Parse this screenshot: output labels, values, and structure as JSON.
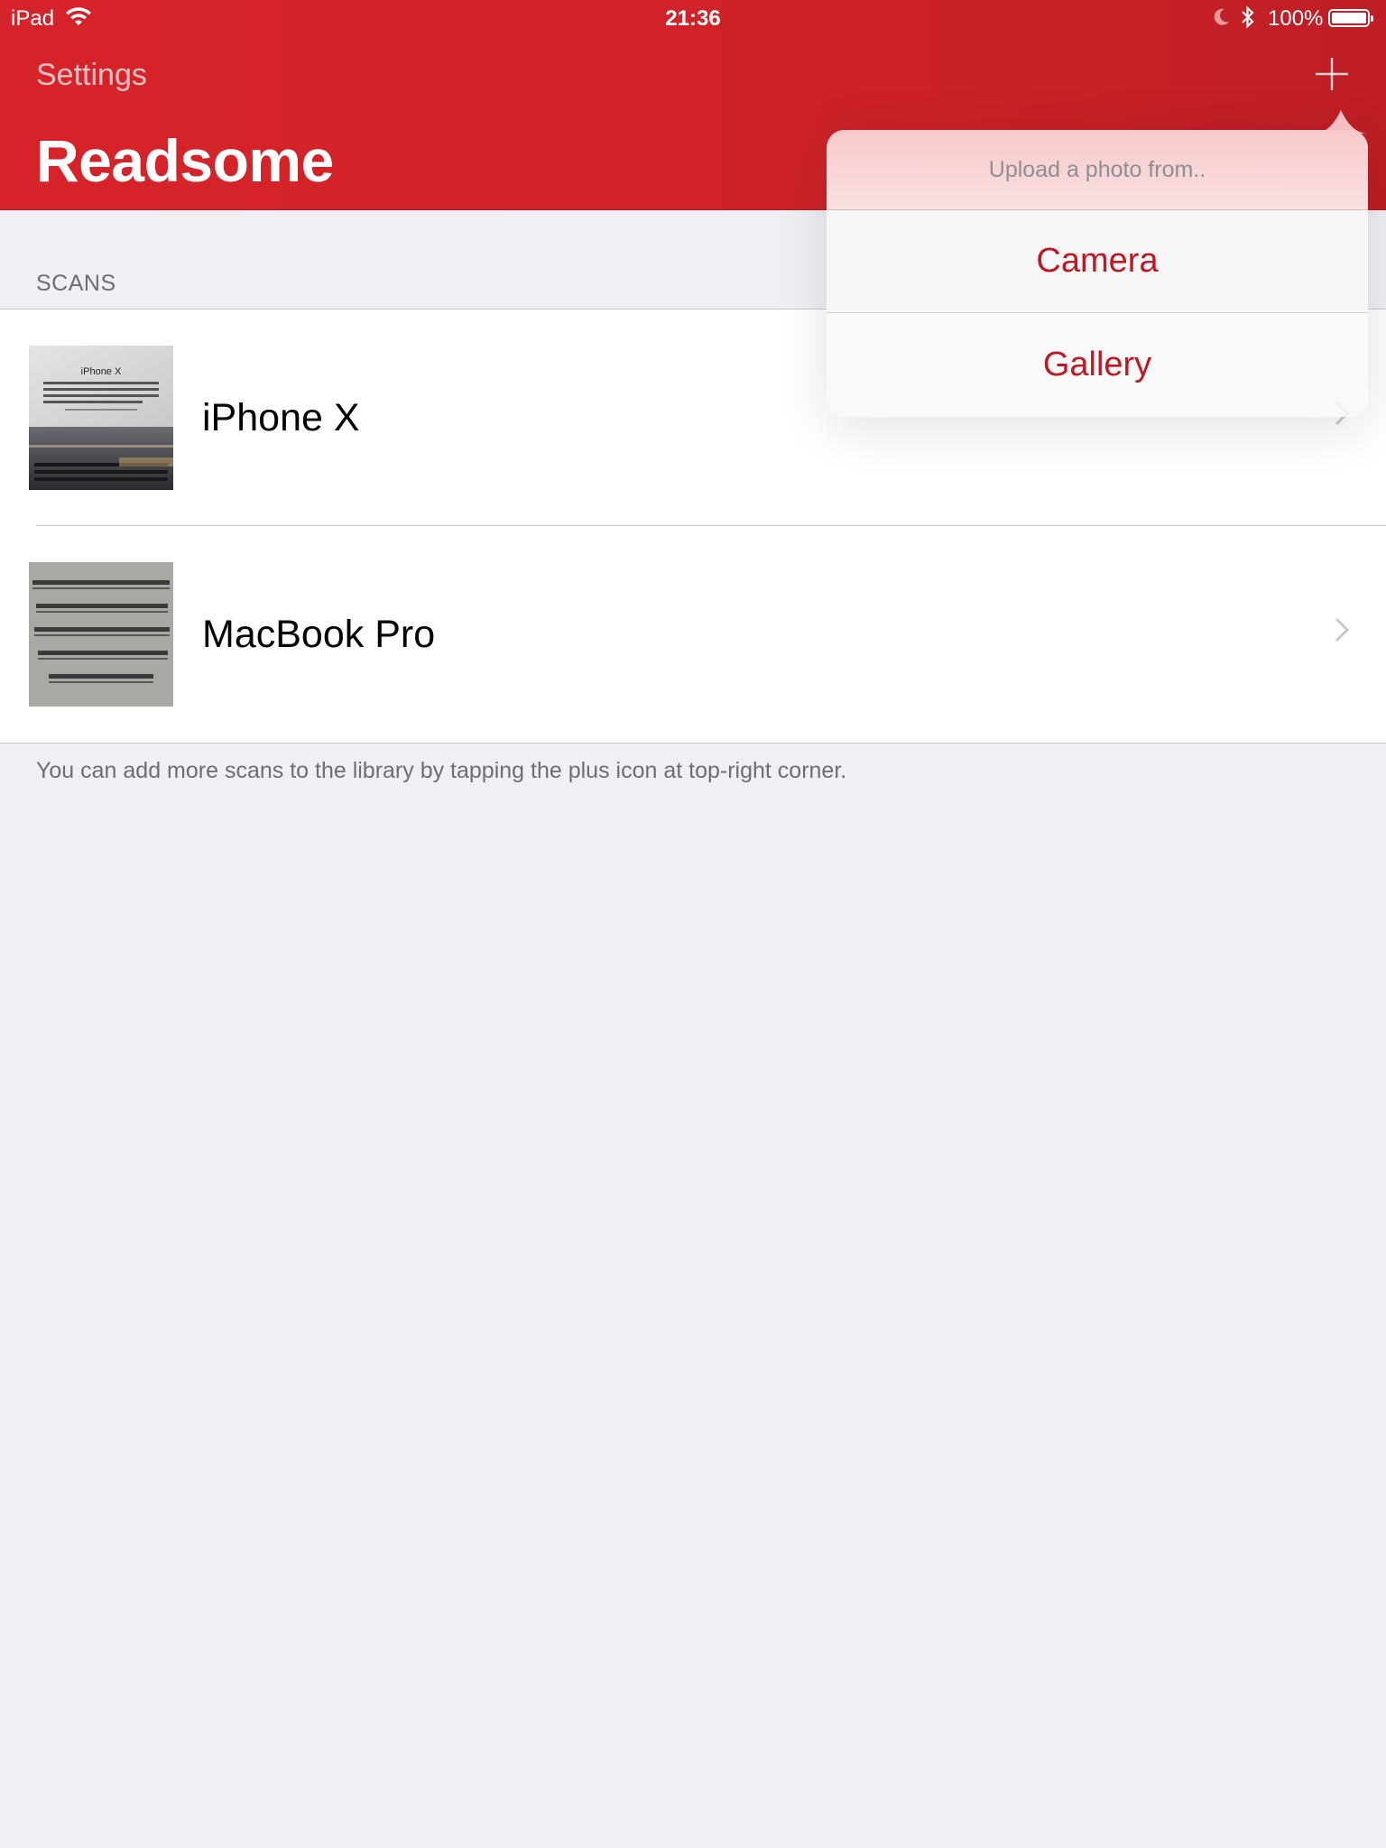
{
  "status_bar": {
    "device": "iPad",
    "time": "21:36",
    "battery": "100%",
    "battery_level": 1.0
  },
  "nav": {
    "back_label": "Settings",
    "title": "Readsome",
    "add_icon": "plus-icon"
  },
  "scans": {
    "section_header": "SCANS",
    "items": [
      {
        "title": "iPhone X",
        "thumb_caption": "iPhone X"
      },
      {
        "title": "MacBook Pro"
      }
    ],
    "footer": "You can add more scans to the library by tapping the plus icon at top-right corner."
  },
  "popover": {
    "title": "Upload a photo from..",
    "options": [
      "Camera",
      "Gallery"
    ]
  },
  "colors": {
    "brand": "#d62329",
    "accent_text": "#c01722",
    "background": "#efeff4"
  }
}
